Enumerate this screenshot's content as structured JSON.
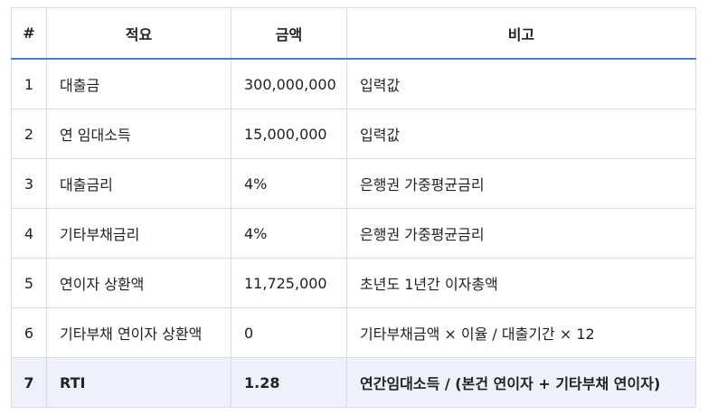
{
  "table": {
    "headers": [
      "#",
      "적요",
      "금액",
      "비고"
    ],
    "rows": [
      {
        "no": "1",
        "item": "대출금",
        "amount": "300,000,000",
        "note": "입력값"
      },
      {
        "no": "2",
        "item": "연 임대소득",
        "amount": "15,000,000",
        "note": "입력값"
      },
      {
        "no": "3",
        "item": "대출금리",
        "amount": "4%",
        "note": "은행권 가중평균금리"
      },
      {
        "no": "4",
        "item": "기타부채금리",
        "amount": "4%",
        "note": "은행권 가중평균금리"
      },
      {
        "no": "5",
        "item": "연이자 상환액",
        "amount": "11,725,000",
        "note": "초년도 1년간 이자총액"
      },
      {
        "no": "6",
        "item": "기타부채 연이자 상환액",
        "amount": "0",
        "note": "기타부채금액 × 이율 / 대출기간 × 12"
      }
    ],
    "total": {
      "no": "7",
      "item": "RTI",
      "amount": "1.28",
      "note": "연간임대소득 / (본건 연이자 + 기타부채 연이자)"
    }
  },
  "colors": {
    "header_rule": "#4a7cc7",
    "total_row_bg": "#eef0fb",
    "border": "#dcdcdc"
  }
}
